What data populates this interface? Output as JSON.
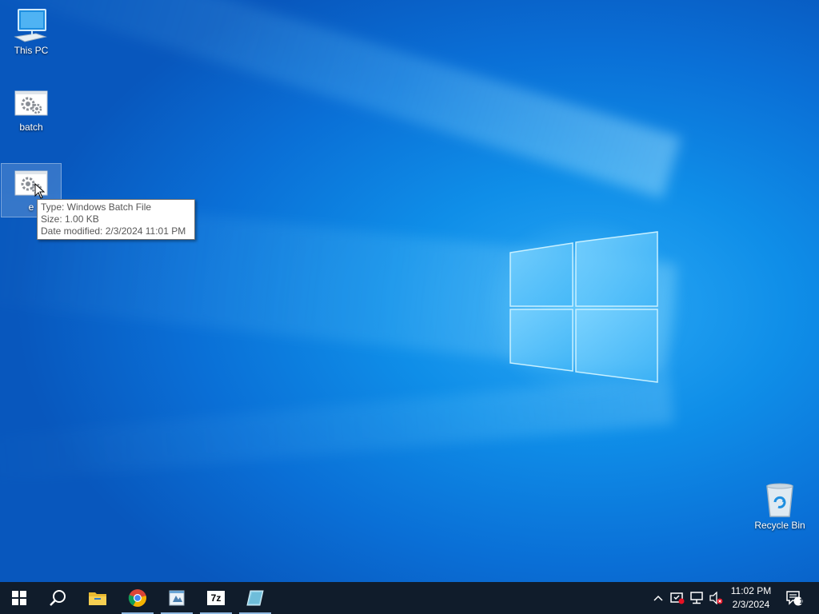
{
  "desktop": {
    "icons": [
      {
        "label": "This PC"
      },
      {
        "label": "batch"
      },
      {
        "label": "e"
      },
      {
        "label": "Recycle Bin"
      }
    ],
    "tooltip": {
      "type": "Type: Windows Batch File",
      "size": "Size: 1.00 KB",
      "modified": "Date modified: 2/3/2024 11:01 PM"
    }
  },
  "taskbar": {
    "buttons": [
      {
        "name": "start",
        "icon": "windows-logo-icon"
      },
      {
        "name": "search",
        "icon": "search-icon"
      },
      {
        "name": "file-explorer",
        "icon": "folder-icon"
      },
      {
        "name": "chrome",
        "icon": "chrome-icon"
      },
      {
        "name": "app",
        "icon": "notepad-app-icon"
      },
      {
        "name": "7zip",
        "icon": "7zip-icon",
        "label": "7z"
      },
      {
        "name": "app2",
        "icon": "glass-app-icon"
      }
    ],
    "clock": {
      "time": "11:02 PM",
      "date": "2/3/2024"
    },
    "notification_count": "1"
  },
  "colors": {
    "taskbar": "#101c2b",
    "desktop_accent": "#0a6fd6"
  }
}
